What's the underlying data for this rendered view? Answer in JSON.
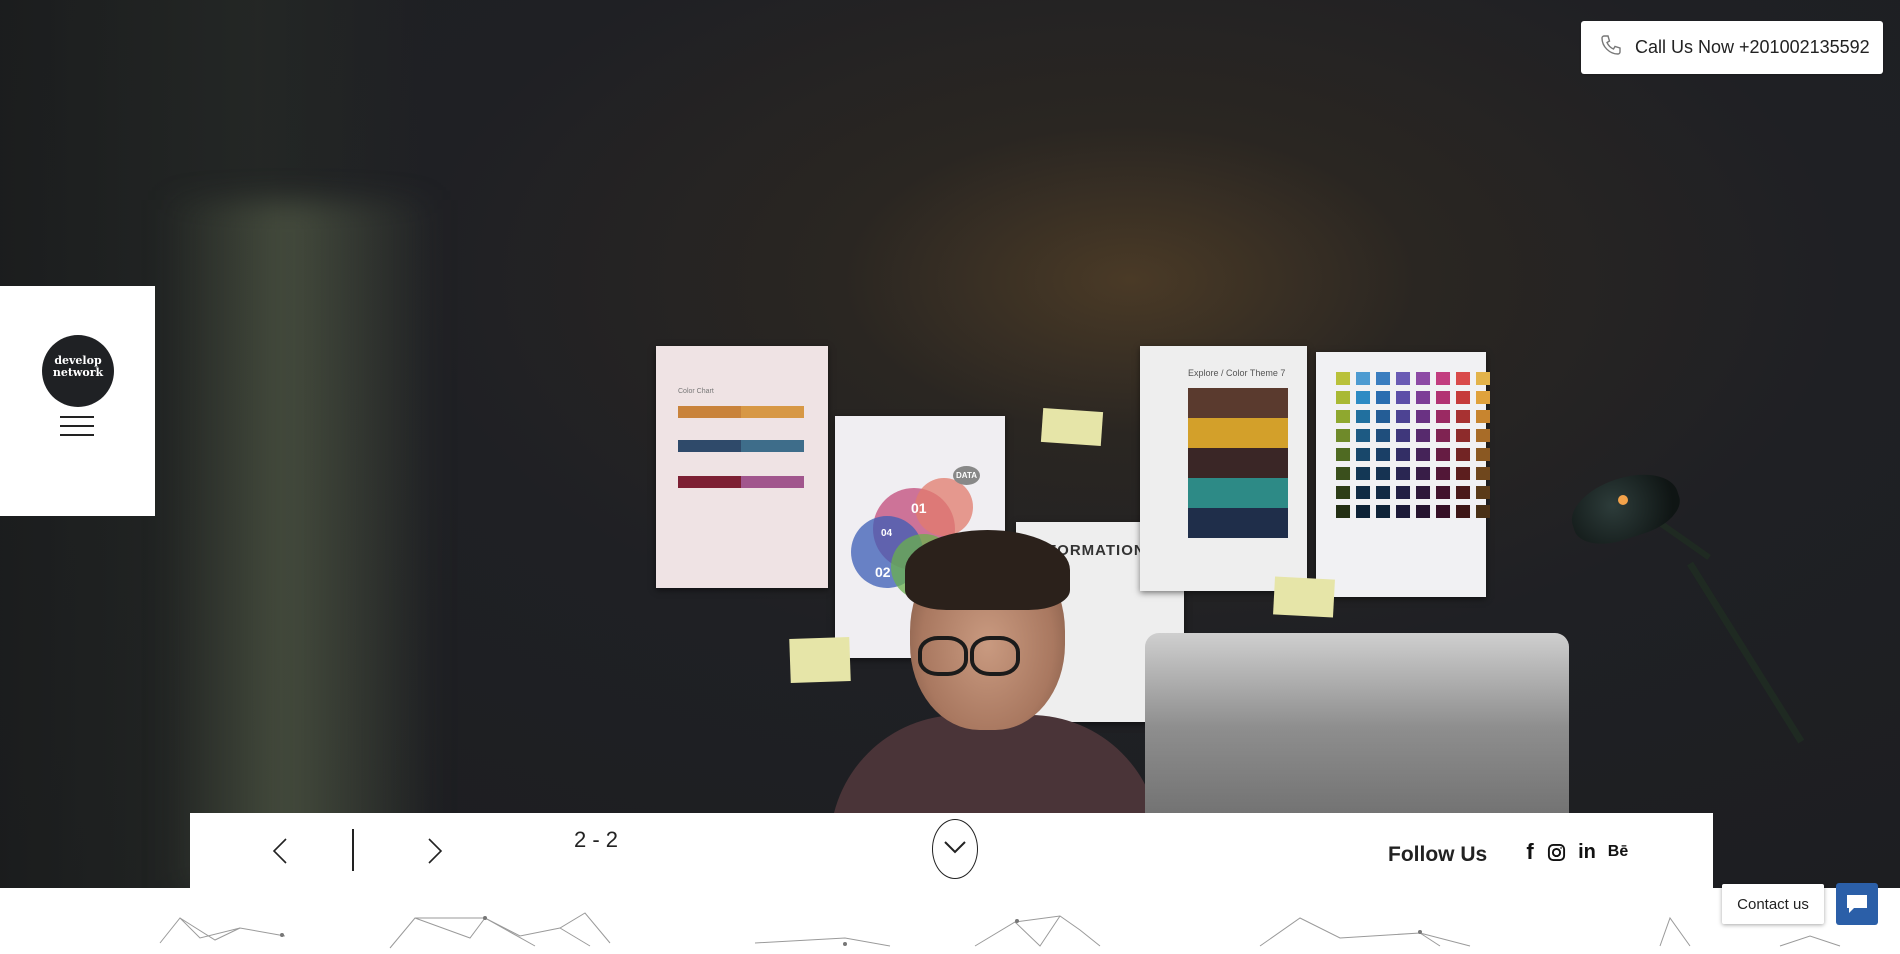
{
  "header": {
    "call_button_label": "Call Us Now +201002135592",
    "call_icon": "phone-icon"
  },
  "side_panel": {
    "logo_line1": "develop",
    "logo_line2": "network",
    "menu_icon": "hamburger-menu-icon"
  },
  "hero": {
    "poster_info_text": "INFORMATION",
    "poster_color_title": "Explore / Color Theme 7",
    "poster_chart_label": "Color Chart",
    "venn_labels": [
      "01",
      "02",
      "04",
      "DATA"
    ]
  },
  "slider": {
    "prev_icon": "chevron-left-icon",
    "next_icon": "chevron-right-icon",
    "counter": "2 - 2",
    "scroll_icon": "chevron-down-icon"
  },
  "follow": {
    "label": "Follow Us",
    "networks": [
      {
        "name": "facebook-icon",
        "glyph": "f"
      },
      {
        "name": "instagram-icon",
        "glyph": ""
      },
      {
        "name": "linkedin-icon",
        "glyph": "in"
      },
      {
        "name": "behance-icon",
        "glyph": "Bē"
      }
    ]
  },
  "contact_widget": {
    "label": "Contact us",
    "icon": "chat-icon",
    "accent": "#2b5fa8"
  }
}
